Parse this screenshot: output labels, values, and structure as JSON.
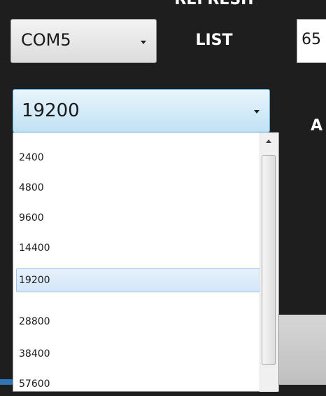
{
  "port_selector": {
    "value": "COM5"
  },
  "refresh_button": {
    "line1": "REFRESH",
    "line2": "LIST"
  },
  "value_field": {
    "value": "65"
  },
  "right_label": {
    "text": "A"
  },
  "baud_selector": {
    "value": "19200",
    "options": [
      "2400",
      "4800",
      "9600",
      "14400",
      "19200",
      "28800",
      "38400",
      "57600"
    ],
    "selected_index": 4
  },
  "colors": {
    "background": "#1e1e1e",
    "selection": "#d3e6f9",
    "combo_focus_border": "#56a8d8",
    "bottom_strip": "#3273b5"
  }
}
